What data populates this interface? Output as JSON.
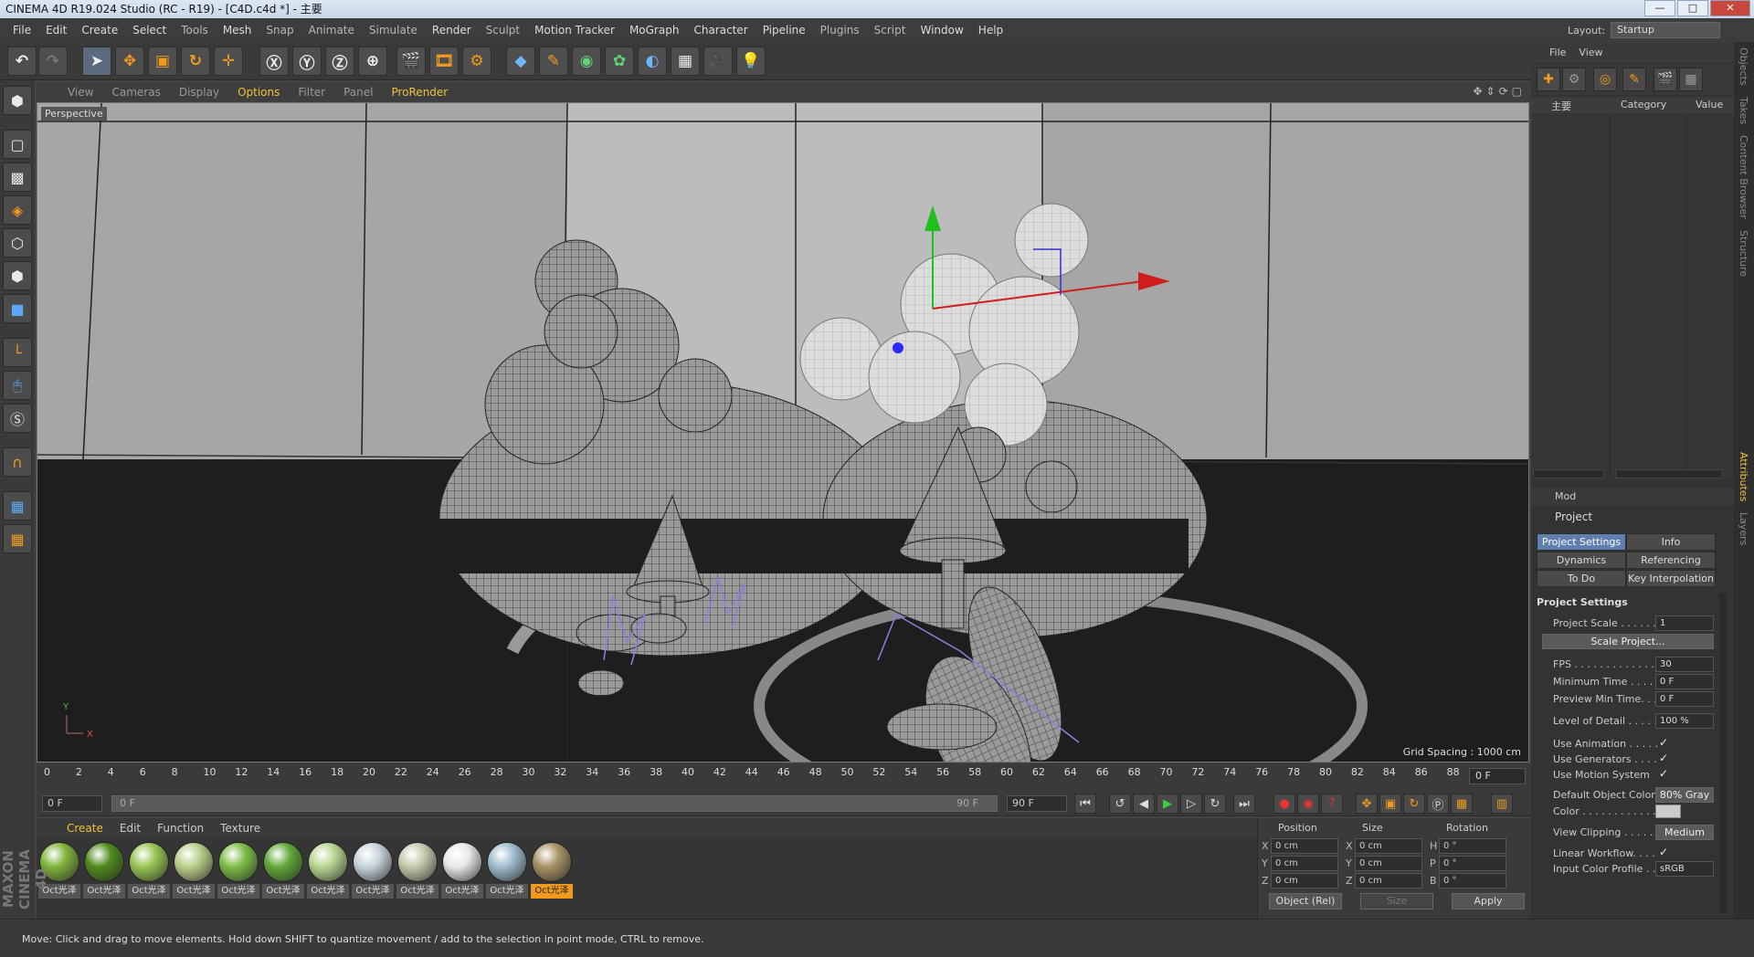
{
  "window": {
    "title": "CINEMA 4D R19.024 Studio (RC - R19) - [C4D.c4d *] - 主要",
    "minimize": "—",
    "maximize": "□",
    "close": "✕"
  },
  "menubar": [
    "File",
    "Edit",
    "Create",
    "Select",
    "Tools",
    "Mesh",
    "Snap",
    "Animate",
    "Simulate",
    "Render",
    "Sculpt",
    "Motion Tracker",
    "MoGraph",
    "Character",
    "Pipeline",
    "Plugins",
    "Script",
    "Window",
    "Help"
  ],
  "layout": {
    "label": "Layout:",
    "value": "Startup"
  },
  "viewport": {
    "menu": [
      "View",
      "Cameras",
      "Display",
      "Options",
      "Filter",
      "Panel",
      "ProRender"
    ],
    "active_menu": "Options",
    "camera_label": "Perspective",
    "grid_spacing": "Grid Spacing : 1000 cm",
    "axis_y": "Y",
    "axis_x": "X"
  },
  "timeline": {
    "ticks": [
      "0",
      "2",
      "4",
      "6",
      "8",
      "10",
      "12",
      "14",
      "16",
      "18",
      "20",
      "22",
      "24",
      "26",
      "28",
      "30",
      "32",
      "34",
      "36",
      "38",
      "40",
      "42",
      "44",
      "46",
      "48",
      "50",
      "52",
      "54",
      "56",
      "58",
      "60",
      "62",
      "64",
      "66",
      "68",
      "70",
      "72",
      "74",
      "76",
      "78",
      "80",
      "82",
      "84",
      "86",
      "88",
      "90"
    ],
    "current_frame": "0 F",
    "start_field": "0 F",
    "slider_left": "0 F",
    "slider_right": "90 F",
    "end_field": "90 F"
  },
  "materials": {
    "menu": [
      "Create",
      "Edit",
      "Function",
      "Texture"
    ],
    "active_menu": "Create",
    "items": [
      {
        "label": "Oct光泽",
        "color": "#7fb33a"
      },
      {
        "label": "Oct光泽",
        "color": "#4f8a1e"
      },
      {
        "label": "Oct光泽",
        "color": "#98c454"
      },
      {
        "label": "Oct光泽",
        "color": "#b9cf8a"
      },
      {
        "label": "Oct光泽",
        "color": "#7dbd46"
      },
      {
        "label": "Oct光泽",
        "color": "#62a93a"
      },
      {
        "label": "Oct光泽",
        "color": "#b8d690"
      },
      {
        "label": "Oct光泽",
        "color": "#c8d4dc"
      },
      {
        "label": "Oct光泽",
        "color": "#c7c9ae"
      },
      {
        "label": "Oct光泽",
        "color": "#e8e8e8"
      },
      {
        "label": "Oct光泽",
        "color": "#9fbccd"
      },
      {
        "label": "Oct光泽",
        "color": "#a89267",
        "selected": true
      }
    ],
    "brand": "MAXON CINEMA 4D"
  },
  "coords": {
    "headers": [
      "Position",
      "Size",
      "Rotation"
    ],
    "rows": [
      {
        "axis": "X",
        "pos": "0 cm",
        "saxis": "X",
        "size": "0 cm",
        "raxis": "H",
        "rot": "0 °"
      },
      {
        "axis": "Y",
        "pos": "0 cm",
        "saxis": "Y",
        "size": "0 cm",
        "raxis": "P",
        "rot": "0 °"
      },
      {
        "axis": "Z",
        "pos": "0 cm",
        "saxis": "Z",
        "size": "0 cm",
        "raxis": "B",
        "rot": "0 °"
      }
    ],
    "mode": "Object (Rel)",
    "size_mode": "Size",
    "apply": "Apply"
  },
  "status": "Move: Click and drag to move elements. Hold down SHIFT to quantize movement / add to the selection in point mode, CTRL to remove.",
  "object_manager": {
    "menu": [
      "File",
      "View"
    ],
    "columns": {
      "name": "主要",
      "category": "Category",
      "value": "Value"
    }
  },
  "attributes": {
    "menu": "Mod",
    "title": "Project",
    "tabs": [
      "Project Settings",
      "Info",
      "Dynamics",
      "Referencing",
      "To Do",
      "Key Interpolation"
    ],
    "active_tab": "Project Settings",
    "section": "Project Settings",
    "rows": [
      {
        "label": "Project Scale . . . . . .",
        "value": "1"
      },
      {
        "label": "Scale Project...",
        "button": true
      },
      {
        "label": "FPS . . . . . . . . . . . . .",
        "value": "30"
      },
      {
        "label": "Minimum Time . . . . .",
        "value": "0 F"
      },
      {
        "label": "Preview Min Time. . .",
        "value": "0 F"
      },
      {
        "label": "Level of Detail . . . . .",
        "value": "100 %"
      },
      {
        "label": "Use Animation . . . . .",
        "check": "✓"
      },
      {
        "label": "Use Generators . . . .",
        "check": "✓"
      },
      {
        "label": "Use Motion System",
        "check": "✓"
      },
      {
        "label": "Default Object Color",
        "value": "80% Gray"
      },
      {
        "label": "Color . . . . . . . . . . . .",
        "swatch": true
      },
      {
        "label": "View Clipping . . . . .",
        "value": "Medium"
      },
      {
        "label": "Linear Workflow. . . .",
        "check": "✓"
      },
      {
        "label": "Input Color Profile . .",
        "value": "sRGB"
      }
    ]
  },
  "side_tabs": [
    "Objects",
    "Takes",
    "Content Browser",
    "Structure",
    "Attributes",
    "Layers"
  ],
  "active_side_tab": "Attributes",
  "colors": {
    "accent": "#f0c23c",
    "select": "#f29a1d",
    "tab_active": "#5f7fb1"
  }
}
